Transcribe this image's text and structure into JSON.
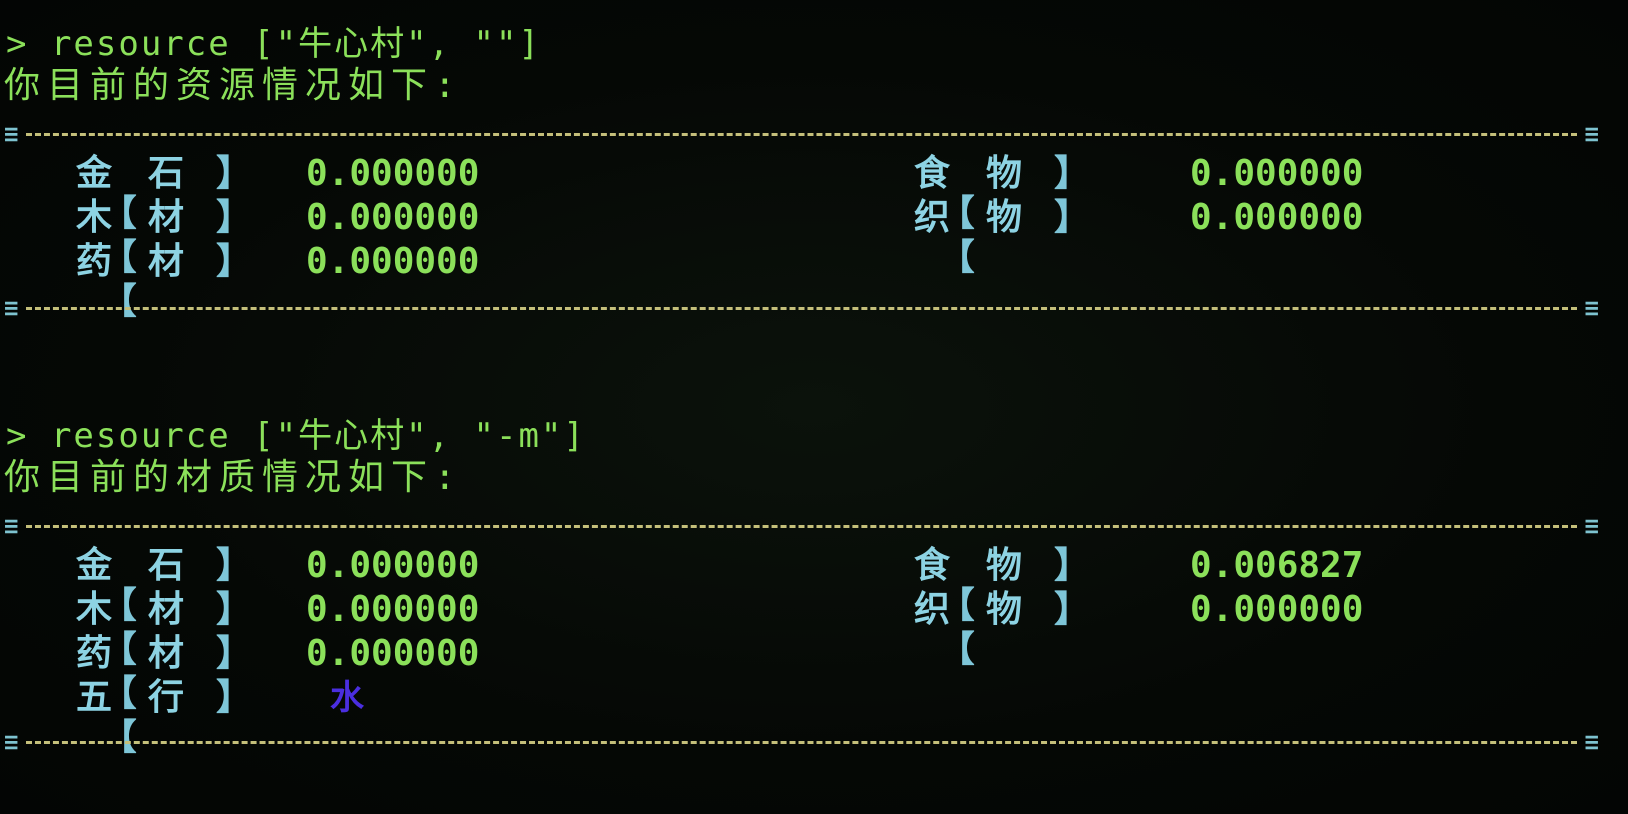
{
  "blocks": [
    {
      "command": "> resource [\"牛心村\", \"\"]",
      "message": "你目前的资源情况如下:",
      "left_items": [
        {
          "open": "【",
          "c1": "金",
          "c2": "石",
          "close": "】",
          "value": "0.000000"
        },
        {
          "open": "【",
          "c1": "木",
          "c2": "材",
          "close": "】",
          "value": "0.000000"
        },
        {
          "open": "【",
          "c1": "药",
          "c2": "材",
          "close": "】",
          "value": "0.000000"
        }
      ],
      "right_items": [
        {
          "open": "【",
          "c1": "食",
          "c2": "物",
          "close": "】",
          "value": "0.000000"
        },
        {
          "open": "【",
          "c1": "织",
          "c2": "物",
          "close": "】",
          "value": "0.000000"
        }
      ]
    },
    {
      "command": "> resource [\"牛心村\", \"-m\"]",
      "message": "你目前的材质情况如下:",
      "left_items": [
        {
          "open": "【",
          "c1": "金",
          "c2": "石",
          "close": "】",
          "value": "0.000000"
        },
        {
          "open": "【",
          "c1": "木",
          "c2": "材",
          "close": "】",
          "value": "0.000000"
        },
        {
          "open": "【",
          "c1": "药",
          "c2": "材",
          "close": "】",
          "value": "0.000000"
        },
        {
          "open": "【",
          "c1": "五",
          "c2": "行",
          "close": "】",
          "value": "水"
        }
      ],
      "right_items": [
        {
          "open": "【",
          "c1": "食",
          "c2": "物",
          "close": "】",
          "value": "0.006827"
        },
        {
          "open": "【",
          "c1": "织",
          "c2": "物",
          "close": "】",
          "value": "0.000000"
        }
      ]
    }
  ],
  "separator_cap": "≡",
  "colors": {
    "prompt_green": "#8be05a",
    "label_cyan": "#8dd3e3",
    "dash_yellow": "#c4bf7a",
    "element_blue": "#4a2ee0",
    "background": "#040706"
  }
}
